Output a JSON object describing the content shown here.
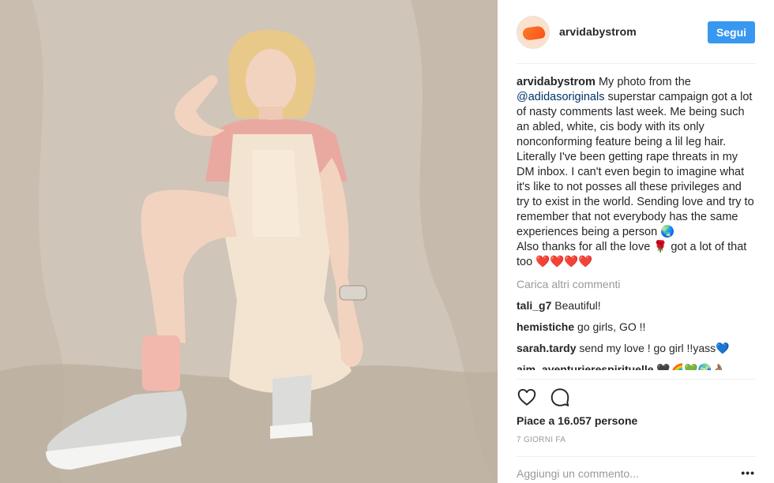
{
  "post": {
    "username": "arvidabystrom",
    "follow_label": "Segui",
    "caption": {
      "user": "arvidabystrom",
      "text_before_mention": " My photo from the ",
      "mention": "@adidasoriginals",
      "text_after_mention": " superstar campaign got a lot of nasty comments last week. Me being such an abled, white, cis body with its only nonconforming feature being a lil leg hair. Literally I've been getting rape threats in my DM inbox. I can't even begin to imagine what it's like to not posses all these privileges and try to exist in the world. Sending love and try to remember that not everybody has the same experiences being a person 🌏",
      "line2": "Also thanks for all the love 🌹 got a lot of that too ❤️❤️❤️❤️"
    },
    "load_more_label": "Carica altri commenti",
    "comments": [
      {
        "user": "tali_g7",
        "text": " Beautiful!"
      },
      {
        "user": "hemistiche",
        "text": " go girls, GO !!"
      },
      {
        "user": "sarah.tardy",
        "text": " send my love ! go girl !!yass💙"
      },
      {
        "user": "aim_aventurierespirituelle",
        "text": " 🖤🌈💚🌍👌🏽"
      }
    ],
    "likes_label": "Piace a 16.057 persone",
    "time_label": "7 GIORNI FA",
    "add_comment_placeholder": "Aggiungi un commento...",
    "more_options_label": "•••"
  },
  "icons": {
    "like": "heart-icon",
    "comment": "comment-bubble-icon",
    "more": "more-options-icon"
  },
  "colors": {
    "follow_button": "#3897f0",
    "mention": "#003569",
    "muted": "#999999"
  }
}
